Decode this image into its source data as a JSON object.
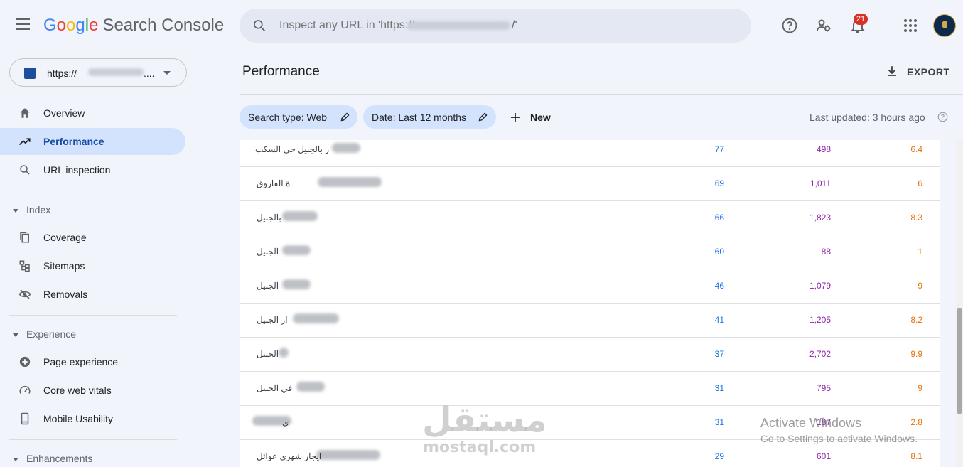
{
  "app": {
    "logo_letters": [
      "G",
      "o",
      "o",
      "g",
      "l",
      "e"
    ],
    "product": "Search Console"
  },
  "search": {
    "placeholder": "Inspect any URL in 'https://",
    "placeholder_tail": "/'"
  },
  "header": {
    "notifications_count": "21"
  },
  "property": {
    "label": "https://",
    "label_tail": "...."
  },
  "sidebar": {
    "items": [
      {
        "label": "Overview",
        "icon": "home-icon"
      },
      {
        "label": "Performance",
        "icon": "trending-up-icon",
        "active": true
      },
      {
        "label": "URL inspection",
        "icon": "search-icon"
      }
    ],
    "index_section": "Index",
    "index_items": [
      {
        "label": "Coverage",
        "icon": "copy-icon"
      },
      {
        "label": "Sitemaps",
        "icon": "sitemap-icon"
      },
      {
        "label": "Removals",
        "icon": "eye-off-icon"
      }
    ],
    "experience_section": "Experience",
    "experience_items": [
      {
        "label": "Page experience",
        "icon": "plus-circle-icon"
      },
      {
        "label": "Core web vitals",
        "icon": "speed-icon"
      },
      {
        "label": "Mobile Usability",
        "icon": "phone-icon"
      }
    ],
    "enhancements_section": "Enhancements"
  },
  "main": {
    "title": "Performance",
    "export_label": "EXPORT",
    "filters": {
      "search_type": "Search type: Web",
      "date": "Date: Last 12 months",
      "new_label": "New"
    },
    "last_updated": "Last updated: 3 hours ago"
  },
  "table": {
    "rows": [
      {
        "query": "ر بالجبيل حي السكب",
        "clicks": "77",
        "impressions": "498",
        "position": "6.4"
      },
      {
        "query": "ة الفاروق",
        "clicks": "69",
        "impressions": "1,011",
        "position": "6"
      },
      {
        "query": "بالجبيل",
        "clicks": "66",
        "impressions": "1,823",
        "position": "8.3"
      },
      {
        "query": "الجبيل",
        "clicks": "60",
        "impressions": "88",
        "position": "1"
      },
      {
        "query": "الجبيل",
        "clicks": "46",
        "impressions": "1,079",
        "position": "9"
      },
      {
        "query": "ار الجبيل",
        "clicks": "41",
        "impressions": "1,205",
        "position": "8.2"
      },
      {
        "query": "الجبيل",
        "clicks": "37",
        "impressions": "2,702",
        "position": "9.9"
      },
      {
        "query": "في الجبيل",
        "clicks": "31",
        "impressions": "795",
        "position": "9"
      },
      {
        "query": "ي",
        "clicks": "31",
        "impressions": "187",
        "position": "2.8"
      },
      {
        "query": "ايجار شهري عوائل",
        "clicks": "29",
        "impressions": "601",
        "position": "8.1"
      }
    ]
  },
  "overlay": {
    "watermark_ar": "مستقل",
    "watermark_en": "mostaql.com",
    "activate_title": "Activate Windows",
    "activate_sub": "Go to Settings to activate Windows."
  }
}
